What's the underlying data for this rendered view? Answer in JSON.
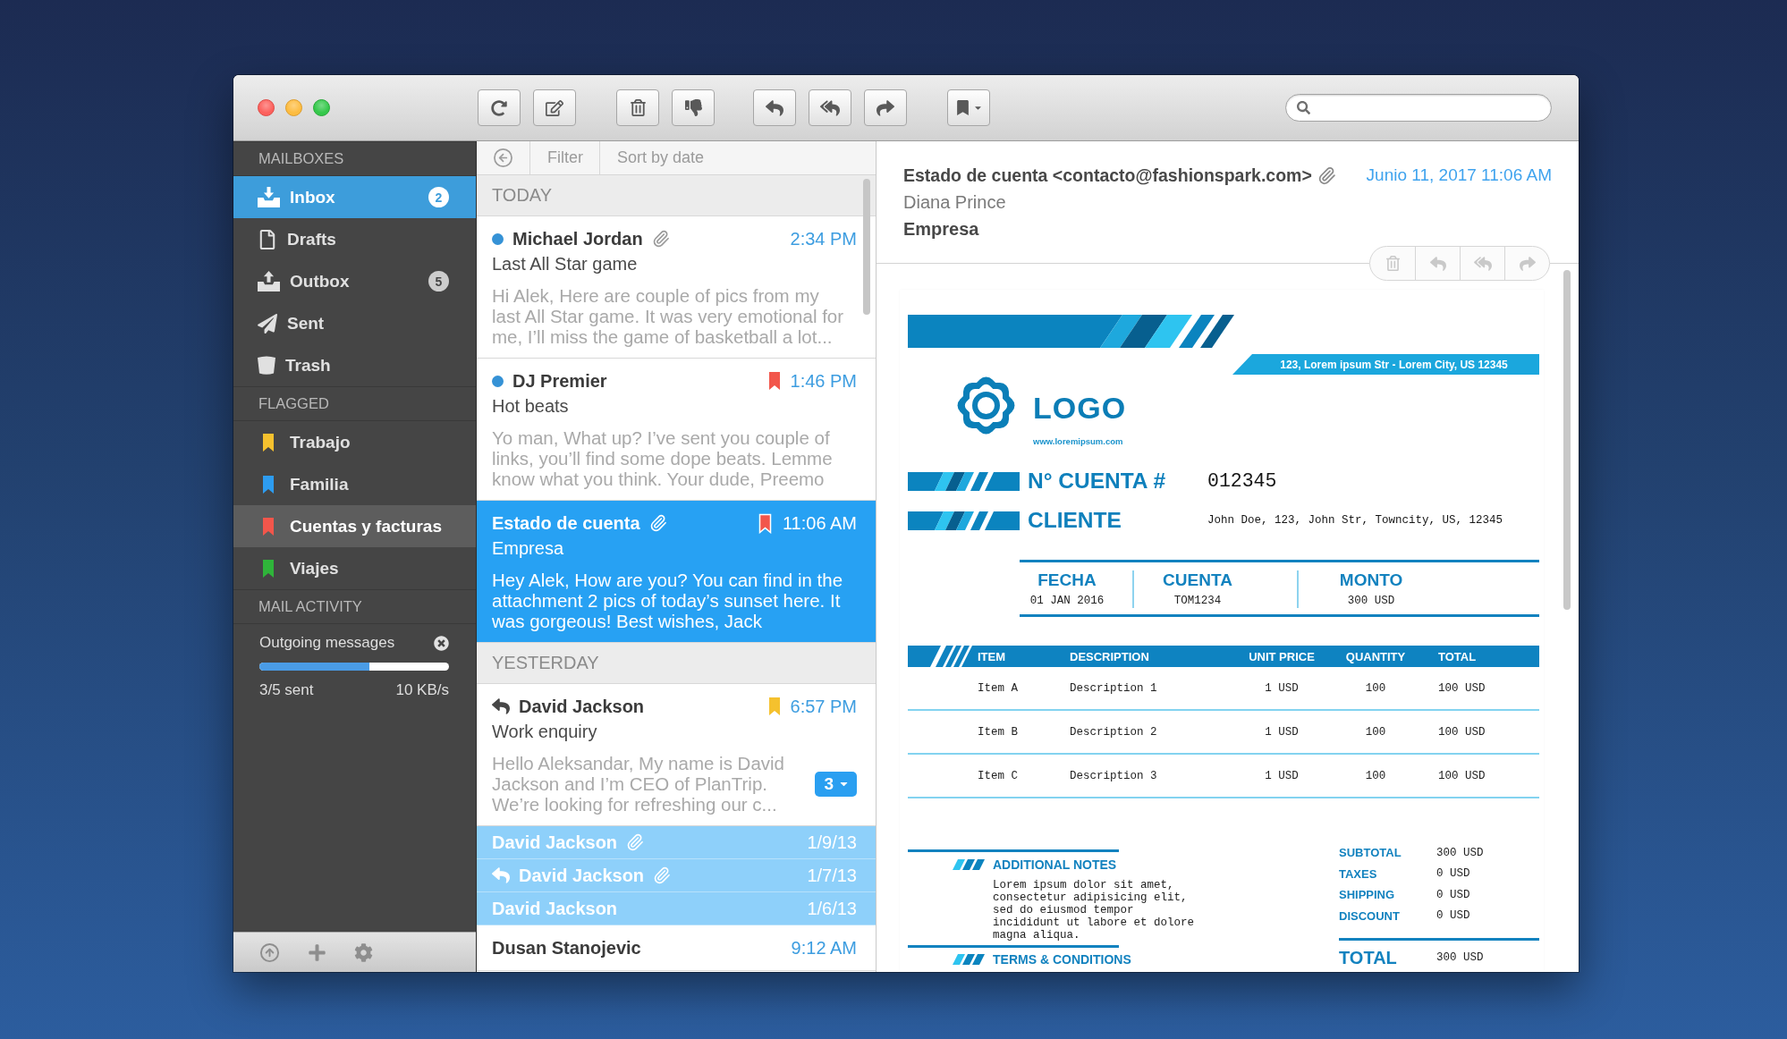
{
  "sidebar": {
    "mailboxes": {
      "title": "MAILBOXES",
      "items": [
        {
          "label": "Inbox",
          "badge": "2",
          "selected": true
        },
        {
          "label": "Drafts",
          "selected": false
        },
        {
          "label": "Outbox",
          "badge": "5",
          "selected": false
        },
        {
          "label": "Sent",
          "selected": false
        },
        {
          "label": "Trash",
          "selected": false
        }
      ]
    },
    "flagged": {
      "title": "FLAGGED",
      "items": [
        {
          "label": "Trabajo",
          "color": "#f5c12e",
          "hovered": false
        },
        {
          "label": "Familia",
          "color": "#2d9cf0",
          "hovered": false
        },
        {
          "label": "Cuentas y facturas",
          "color": "#f2564b",
          "hovered": true
        },
        {
          "label": "Viajes",
          "color": "#2fb43a",
          "hovered": false
        }
      ]
    },
    "activity": {
      "title": "MAIL ACTIVITY",
      "label": "Outgoing messages",
      "level": 0.58,
      "progress": "3/5 sent",
      "speed": "10 KB/s"
    }
  },
  "message_list": {
    "filter": "Filter",
    "sort": "Sort by date",
    "groups": [
      {
        "title": "TODAY",
        "messages": [
          {
            "sender": "Michael Jordan",
            "unread": true,
            "replied": false,
            "attachment": true,
            "time": "2:34 PM",
            "subject": "Last All Star game",
            "preview": "Hi Alek, Here are couple of pics from my last All Star game. It was very emotional for me, I’ll miss the game of basketball a lot...",
            "selected": false
          },
          {
            "sender": "DJ Premier",
            "unread": true,
            "replied": false,
            "attachment": false,
            "flag": {
              "color": "#f2564b"
            },
            "time": "1:46 PM",
            "subject": "Hot beats",
            "preview": "Yo man, What up? I’ve sent you couple of links, you’ll find some dope beats. Lemme know what you think. Your dude, Preemo",
            "selected": false
          },
          {
            "sender": "Estado de cuenta",
            "unread": false,
            "replied": false,
            "attachment": true,
            "flag": {
              "color": "#f2564b"
            },
            "time": "11:06 AM",
            "subject": "Empresa",
            "preview": "Hey Alek, How are you? You can find in the attachment 2 pics of today’s sunset here. It was gorgeous! Best wishes, Jack",
            "selected": true
          }
        ]
      },
      {
        "title": "YESTERDAY",
        "messages": [
          {
            "sender": "David Jackson",
            "unread": false,
            "replied": true,
            "attachment": false,
            "flag": {
              "color": "#f5c12e"
            },
            "time": "6:57 PM",
            "subject": "Work enquiry",
            "preview": "Hello Aleksandar, My name is David Jackson and I’m CEO of PlanTrip. We’re looking for refreshing our c...",
            "selected": false,
            "thread_count": "3",
            "thread": [
              {
                "sender": "David Jackson",
                "replied": false,
                "attachment": true,
                "date": "1/9/13"
              },
              {
                "sender": "David Jackson",
                "replied": true,
                "attachment": true,
                "date": "1/7/13"
              },
              {
                "sender": "David Jackson",
                "replied": false,
                "attachment": false,
                "date": "1/6/13"
              }
            ]
          },
          {
            "sender": "Dusan Stanojevic",
            "unread": false,
            "replied": false,
            "attachment": false,
            "time": "9:12 AM",
            "selected": false
          }
        ]
      }
    ]
  },
  "reading_pane": {
    "sender": "Estado de cuenta <contacto@fashionspark.com>",
    "attachment": true,
    "date": "Junio 11, 2017 11:06 AM",
    "recipient": "Diana Prince",
    "subject": "Empresa",
    "invoice": {
      "address": "123, Lorem ipsum Str - Lorem City, US 12345",
      "logo": "LOGO",
      "website": "www.loremipsum.com",
      "account_label": "N° CUENTA #",
      "account_number": "012345",
      "client_label": "CLIENTE",
      "client": "John Doe, 123, John Str, Towncity, US, 12345",
      "summary": [
        {
          "label": "FECHA",
          "value": "01 JAN 2016"
        },
        {
          "label": "CUENTA",
          "value": "TOM1234"
        },
        {
          "label": "MONTO",
          "value": "300 USD"
        }
      ],
      "table": {
        "columns": [
          "ITEM",
          "DESCRIPTION",
          "UNIT PRICE",
          "QUANTITY",
          "TOTAL"
        ],
        "rows": [
          [
            "Item A",
            "Description 1",
            "1 USD",
            "100",
            "100 USD"
          ],
          [
            "Item B",
            "Description 2",
            "1 USD",
            "100",
            "100 USD"
          ],
          [
            "Item C",
            "Description 3",
            "1 USD",
            "100",
            "100 USD"
          ]
        ]
      },
      "notes": {
        "title": "ADDITIONAL NOTES",
        "text": "Lorem ipsum dolor sit amet, consectetur adipisicing elit, sed do eiusmod tempor incididunt ut labore et dolore magna aliqua."
      },
      "totals": [
        {
          "label": "SUBTOTAL",
          "value": "300 USD"
        },
        {
          "label": "TAXES",
          "value": "0 USD"
        },
        {
          "label": "SHIPPING",
          "value": "0 USD"
        },
        {
          "label": "DISCOUNT",
          "value": "0 USD"
        }
      ],
      "grand_total": {
        "label": "TOTAL",
        "value": "300 USD"
      },
      "terms_title": "TERMS & CONDITIONS"
    }
  }
}
